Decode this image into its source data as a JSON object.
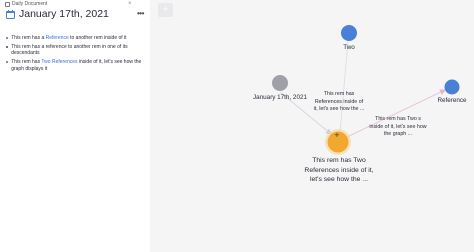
{
  "document": {
    "breadcrumb": "Daily Document",
    "title": "January 17th, 2021",
    "rems": [
      {
        "before": "This rem has a ",
        "ref": "Reference",
        "after": " to another rem inside of it"
      },
      {
        "before": "This rem has a reference to another rem in one of its descendants",
        "ref": "",
        "after": ""
      },
      {
        "before": "This rem has ",
        "ref": "Two",
        "ref2": "References",
        "after": " inside of it, let's see how the graph displays it"
      }
    ]
  },
  "graph": {
    "nodes": {
      "two": {
        "label": "Two",
        "color": "#4a7fd6"
      },
      "reference": {
        "label": "Reference",
        "color": "#4a7fd6"
      },
      "january": {
        "label": "January 17th, 2021",
        "color": "#a0a0a8"
      },
      "main": {
        "label": "This rem has Two References inside of it, let's see how the ...",
        "color": "#f0a92e"
      }
    },
    "edge_labels": {
      "upper": "This rem has References inside of it, let's see how the ...",
      "right": "This rem has Two s inside of it, let's see how the graph ..."
    },
    "cursor": "+",
    "button_icon": "+"
  }
}
